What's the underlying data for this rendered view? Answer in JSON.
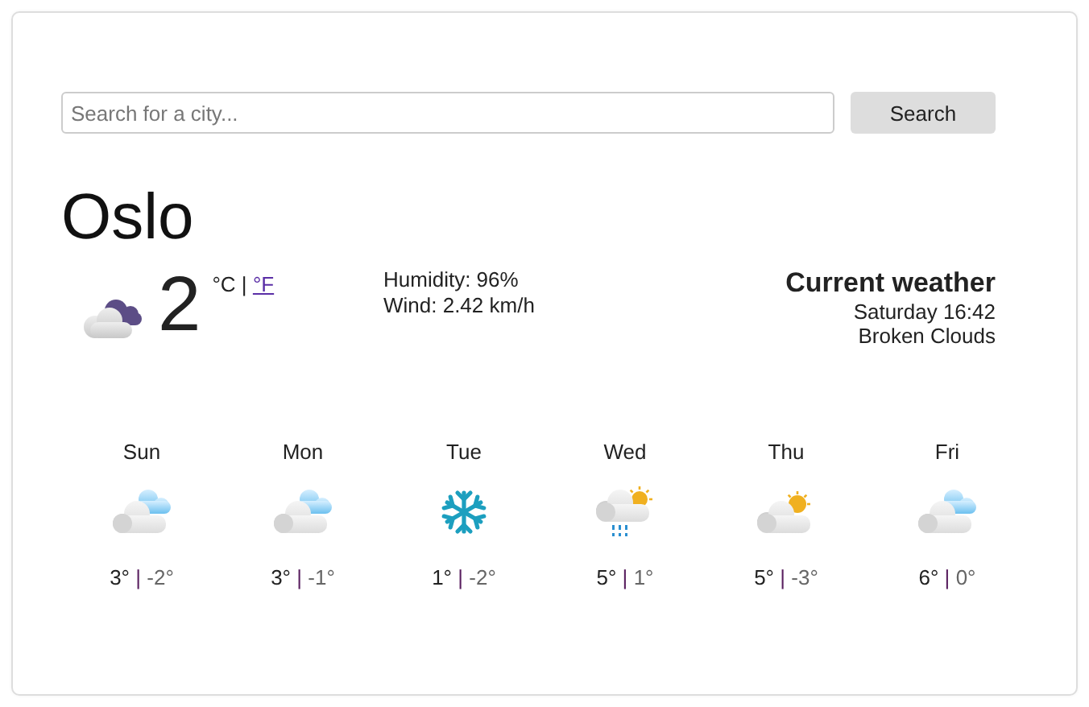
{
  "search": {
    "placeholder": "Search for a city...",
    "button": "Search"
  },
  "current": {
    "city": "Oslo",
    "kind": "broken-clouds",
    "temperature": "2",
    "unit_celsius": "°C",
    "unit_separator": "|",
    "unit_fahrenheit": "°F",
    "humidity": "Humidity: 96%",
    "wind": "Wind: 2.42 km/h",
    "heading": "Current weather",
    "datetime": "Saturday 16:42",
    "description": "Broken Clouds"
  },
  "forecast": [
    {
      "day": "Sun",
      "kind": "cloudy",
      "high": "3°",
      "separator": "|",
      "low": "-2°"
    },
    {
      "day": "Mon",
      "kind": "cloudy",
      "high": "3°",
      "separator": "|",
      "low": "-1°"
    },
    {
      "day": "Tue",
      "kind": "snow",
      "high": "1°",
      "separator": "|",
      "low": "-2°"
    },
    {
      "day": "Wed",
      "kind": "rain-sun",
      "high": "5°",
      "separator": "|",
      "low": "1°"
    },
    {
      "day": "Thu",
      "kind": "partly-sunny",
      "high": "5°",
      "separator": "|",
      "low": "-3°"
    },
    {
      "day": "Fri",
      "kind": "cloudy",
      "high": "6°",
      "separator": "|",
      "low": "0°"
    }
  ]
}
